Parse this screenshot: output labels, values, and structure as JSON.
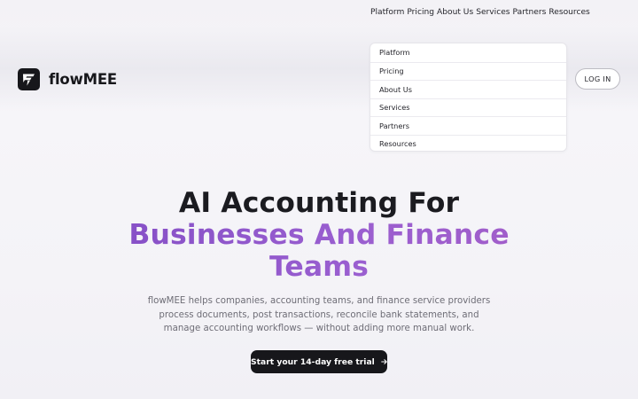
{
  "top_nav": [
    "Platform",
    "Pricing",
    "About Us",
    "Services",
    "Partners",
    "Resources"
  ],
  "brand": {
    "name": "flowMEE",
    "icon": "flowmee-logo-icon"
  },
  "menu": [
    "Platform",
    "Pricing",
    "About Us",
    "Services",
    "Partners",
    "Resources"
  ],
  "login_label": "LOG IN",
  "hero": {
    "line1": "AI Accounting For",
    "line2": "Businesses And Finance",
    "line3": "Teams",
    "subtitle": "flowMEE helps companies, accounting teams, and finance service providers process documents, post transactions, reconcile bank statements, and manage accounting workflows — without adding more manual work.",
    "cta_label": "Start your 14-day free trial",
    "cta_icon": "arrow-right-icon"
  },
  "colors": {
    "accent": "#8d55c9",
    "dark": "#17171b",
    "background": "#f4f3f7"
  }
}
